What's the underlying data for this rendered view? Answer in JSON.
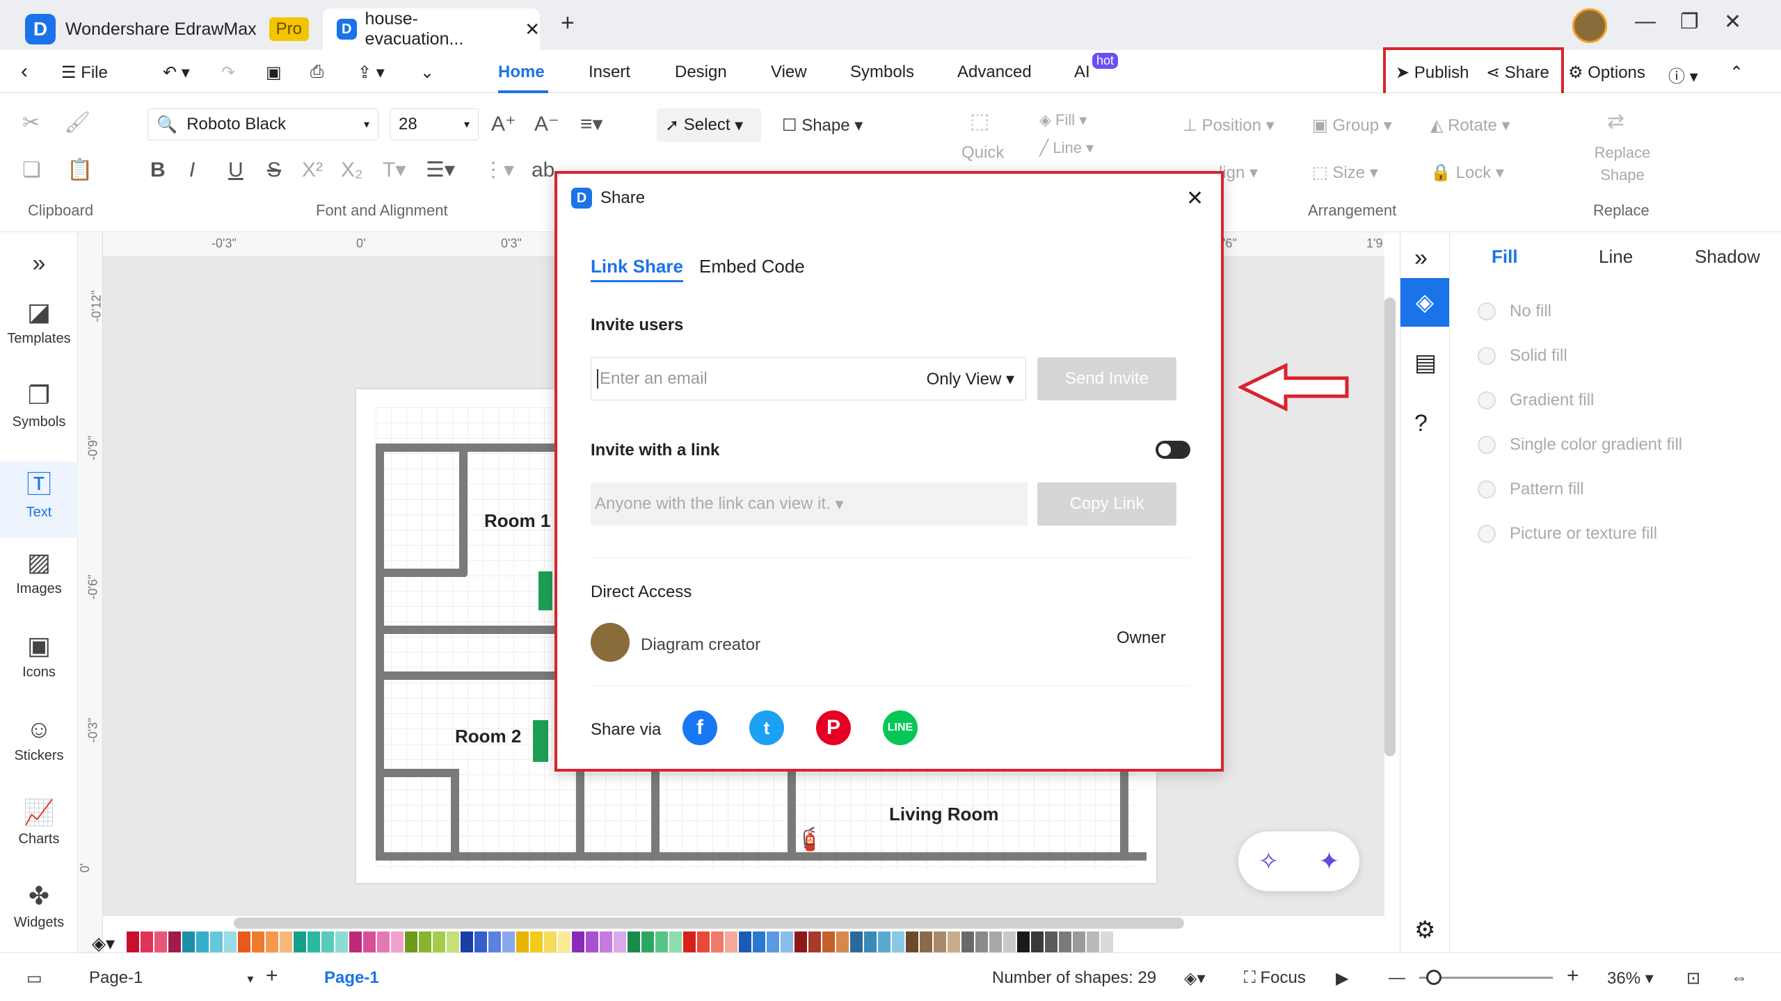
{
  "titlebar": {
    "app_title": "Wondershare EdrawMax",
    "pro_badge": "Pro",
    "doc_tab": "house-evacuation...",
    "app_icon": "D",
    "tab_icon": "D"
  },
  "menu": {
    "file": "File",
    "tabs": [
      "Home",
      "Insert",
      "Design",
      "View",
      "Symbols",
      "Advanced",
      "AI"
    ],
    "hot_badge": "hot",
    "publish": "Publish",
    "share": "Share",
    "options": "Options"
  },
  "ribbon": {
    "font_name": "Roboto Black",
    "font_size": "28",
    "select": "Select",
    "shape": "Shape",
    "quick": "Quick",
    "fill": "Fill",
    "line": "Line",
    "position": "Position",
    "group": "Group",
    "rotate": "Rotate",
    "align": "lign",
    "size": "Size",
    "lock": "Lock",
    "replace_shape": "Replace Shape",
    "groups": {
      "clipboard": "Clipboard",
      "font": "Font and Alignment",
      "arrangement": "Arrangement",
      "replace": "Replace"
    },
    "ab": "ab"
  },
  "sidebar": {
    "items": [
      {
        "label": "Templates"
      },
      {
        "label": "Symbols"
      },
      {
        "label": "Text"
      },
      {
        "label": "Images"
      },
      {
        "label": "Icons"
      },
      {
        "label": "Stickers"
      },
      {
        "label": "Charts"
      },
      {
        "label": "Widgets"
      }
    ]
  },
  "ruler": {
    "h": [
      "-0'3\"",
      "0'",
      "0'3\"",
      "'6\"",
      "1'9"
    ],
    "v": [
      "-0'12\"",
      "-0'9\"",
      "-0'6\"",
      "-0'3\"",
      "0'"
    ]
  },
  "diagram": {
    "rooms": [
      "Room 1",
      "Room 2",
      "Living Room"
    ]
  },
  "dialog": {
    "title": "Share",
    "tabs": [
      "Link Share",
      "Embed Code"
    ],
    "invite_users": "Invite users",
    "email_placeholder": "Enter an email",
    "permission": "Only View",
    "send_invite": "Send Invite",
    "invite_link": "Invite with a link",
    "link_permission": "Anyone with the link can view it.",
    "copy_link": "Copy Link",
    "direct_access": "Direct Access",
    "user_name": "Diagram creator",
    "user_role": "Owner",
    "share_via": "Share via"
  },
  "fillpanel": {
    "tabs": [
      "Fill",
      "Line",
      "Shadow"
    ],
    "options": [
      "No fill",
      "Solid fill",
      "Gradient fill",
      "Single color gradient fill",
      "Pattern fill",
      "Picture or texture fill"
    ]
  },
  "status": {
    "page_selector": "Page-1",
    "page_tab": "Page-1",
    "shapes": "Number of shapes: 29",
    "focus": "Focus",
    "zoom": "36%"
  },
  "colors": {
    "accent": "#1a73e8",
    "highlight": "#d9232d"
  }
}
